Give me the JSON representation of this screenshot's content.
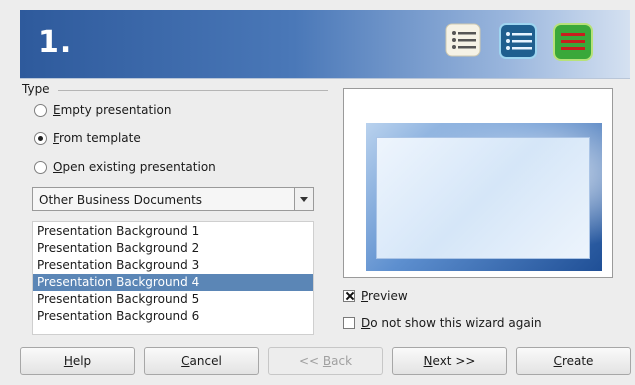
{
  "banner": {
    "step": "1.",
    "icons": [
      "list-icon",
      "list-icon-blue",
      "list-icon-green"
    ]
  },
  "type_group": {
    "label": "Type",
    "options": [
      {
        "pre": "",
        "mnemonic": "E",
        "post": "mpty presentation",
        "selected": false
      },
      {
        "pre": "",
        "mnemonic": "F",
        "post": "rom template",
        "selected": true
      },
      {
        "pre": "",
        "mnemonic": "O",
        "post": "pen existing presentation",
        "selected": false
      }
    ]
  },
  "category": {
    "value": "Other Business Documents"
  },
  "templates": {
    "items": [
      "Presentation Background 1",
      "Presentation Background 2",
      "Presentation Background 3",
      "Presentation Background 4",
      "Presentation Background 5",
      "Presentation Background 6"
    ],
    "selected_index": 3
  },
  "preview_checkbox": {
    "mnemonic": "P",
    "post": "review",
    "checked": true
  },
  "dont_show_checkbox": {
    "mnemonic": "D",
    "post": "o not show this wizard again",
    "checked": false
  },
  "buttons": {
    "help": {
      "mnemonic": "H",
      "post": "elp",
      "pre": ""
    },
    "cancel": {
      "mnemonic": "C",
      "post": "ancel",
      "pre": ""
    },
    "back": {
      "pre": "<< ",
      "mnemonic": "B",
      "post": "ack",
      "enabled": false
    },
    "next": {
      "pre": "",
      "mnemonic": "N",
      "post": "ext >>"
    },
    "create": {
      "pre": "",
      "mnemonic": "C",
      "post": "reate"
    }
  },
  "colors": {
    "banner_start": "#2e5a9c",
    "selection": "#5b86b6"
  }
}
